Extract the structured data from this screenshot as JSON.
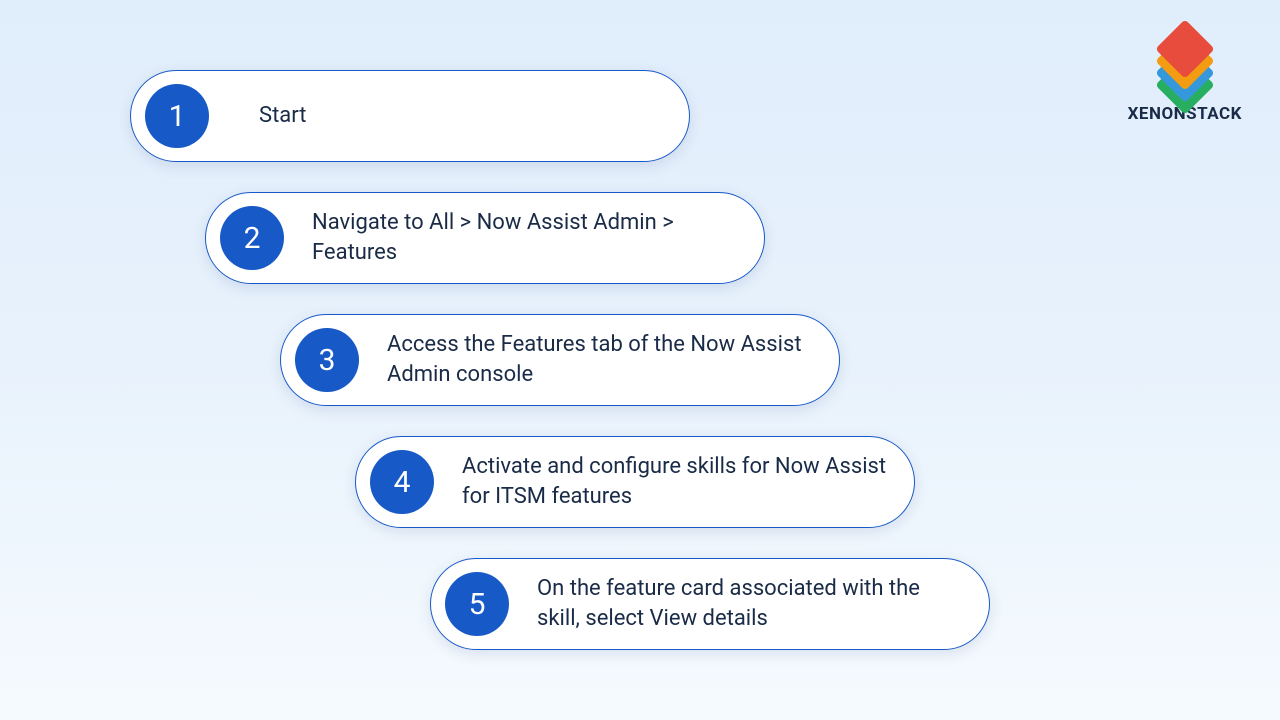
{
  "brand": {
    "name": "XENONSTACK"
  },
  "steps": [
    {
      "num": "1",
      "text": "Start"
    },
    {
      "num": "2",
      "text": "Navigate to All > Now Assist Admin > Features"
    },
    {
      "num": "3",
      "text": "Access the Features tab of the Now Assist Admin console"
    },
    {
      "num": "4",
      "text": "Activate and configure skills for Now Assist for ITSM features"
    },
    {
      "num": "5",
      "text": "On the feature card associated with the skill, select View details"
    }
  ]
}
